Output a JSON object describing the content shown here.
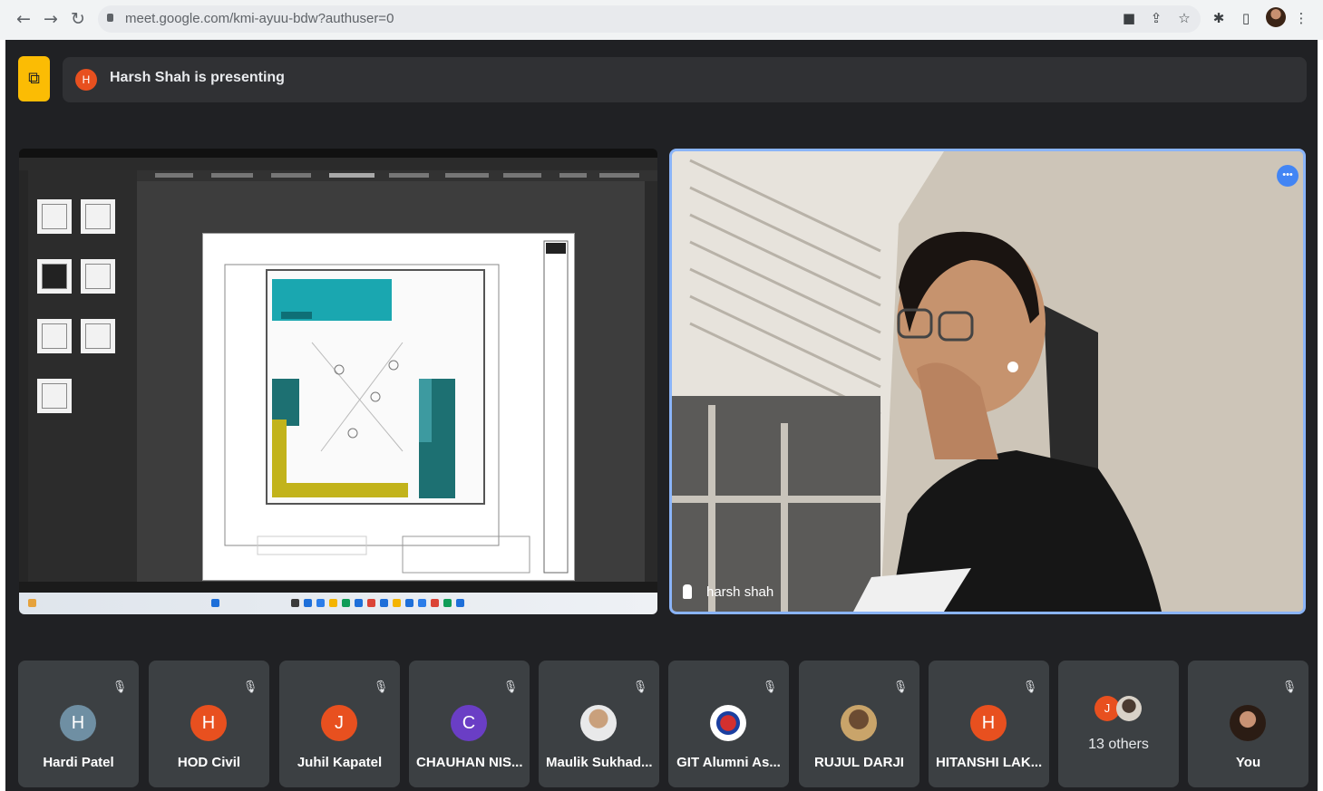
{
  "browser": {
    "back_icon": "arrow-left-icon",
    "forward_icon": "arrow-right-icon",
    "reload_icon": "reload-icon",
    "url": "meet.google.com/kmi-ayuu-bdw?authuser=0"
  },
  "meet": {
    "presenting_text": "Harsh Shah is presenting",
    "presenter_initial": "H",
    "speaker_name": "harsh shah",
    "colors": {
      "background": "#202124",
      "tile": "#3c4043",
      "accent": "#8ab4f8",
      "present_badge": "#fbbc04"
    }
  },
  "participants": [
    {
      "name": "Hardi Patel",
      "initial": "H",
      "color": "#6f8fa3"
    },
    {
      "name": "HOD Civil",
      "initial": "H",
      "color": "#e8501f"
    },
    {
      "name": "Juhil Kapatel",
      "initial": "J",
      "color": "#e8501f"
    },
    {
      "name": "CHAUHAN NIS...",
      "initial": "C",
      "color": "#6a3ec5"
    },
    {
      "name": "Maulik Sukhad...",
      "initial": "",
      "color": "#b8a48c"
    },
    {
      "name": "GIT Alumni As...",
      "initial": "",
      "color": "#e8eaed"
    },
    {
      "name": "RUJUL DARJI",
      "initial": "",
      "color": "#a0784a"
    },
    {
      "name": "HITANSHI LAK...",
      "initial": "H",
      "color": "#e8501f"
    }
  ],
  "others": {
    "label": "13 others",
    "initial": "J"
  },
  "self": {
    "name": "You"
  }
}
